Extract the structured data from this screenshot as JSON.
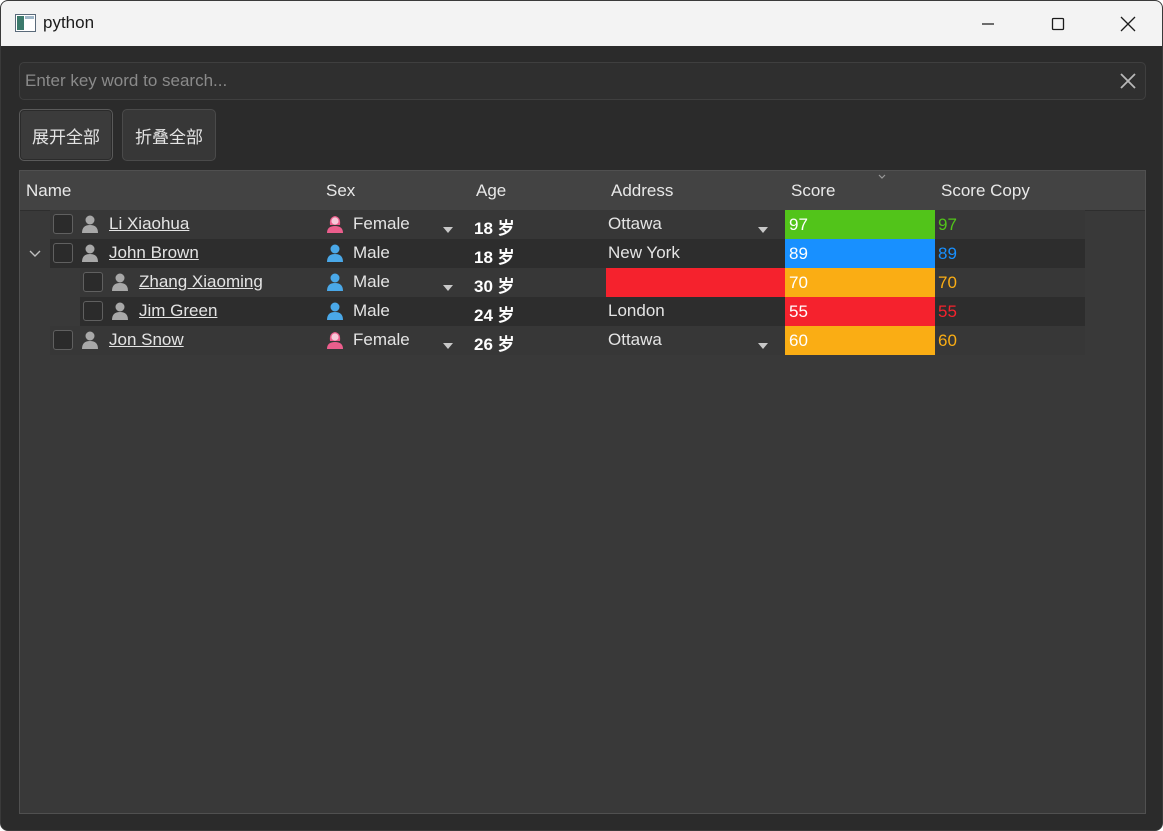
{
  "window": {
    "title": "python"
  },
  "search": {
    "placeholder": "Enter key word to search..."
  },
  "buttons": {
    "expand_all": "展开全部",
    "collapse_all": "折叠全部"
  },
  "columns": [
    "Name",
    "Sex",
    "Age",
    "Address",
    "Score",
    "Score Copy"
  ],
  "colors": {
    "green": "#52c41a",
    "blue": "#1890ff",
    "orange": "#faad14",
    "red": "#f5222d",
    "female": "#eb5e8c",
    "male": "#4aa8e8"
  },
  "rows": [
    {
      "name": "Li Xiaohua",
      "sex": "Female",
      "age": "18 岁",
      "address": "Ottawa",
      "score": "97",
      "score_copy": "97",
      "level": 0,
      "expandable": false
    },
    {
      "name": "John Brown",
      "sex": "Male",
      "age": "18 岁",
      "address": "New York",
      "score": "89",
      "score_copy": "89",
      "level": 0,
      "expandable": true
    },
    {
      "name": "Zhang Xiaoming",
      "sex": "Male",
      "age": "30 岁",
      "address": "",
      "score": "70",
      "score_copy": "70",
      "level": 1,
      "expandable": false
    },
    {
      "name": "Jim Green",
      "sex": "Male",
      "age": "24 岁",
      "address": "London",
      "score": "55",
      "score_copy": "55",
      "level": 1,
      "expandable": false
    },
    {
      "name": "Jon Snow",
      "sex": "Female",
      "age": "26 岁",
      "address": "Ottawa",
      "score": "60",
      "score_copy": "60",
      "level": 0,
      "expandable": false
    }
  ]
}
